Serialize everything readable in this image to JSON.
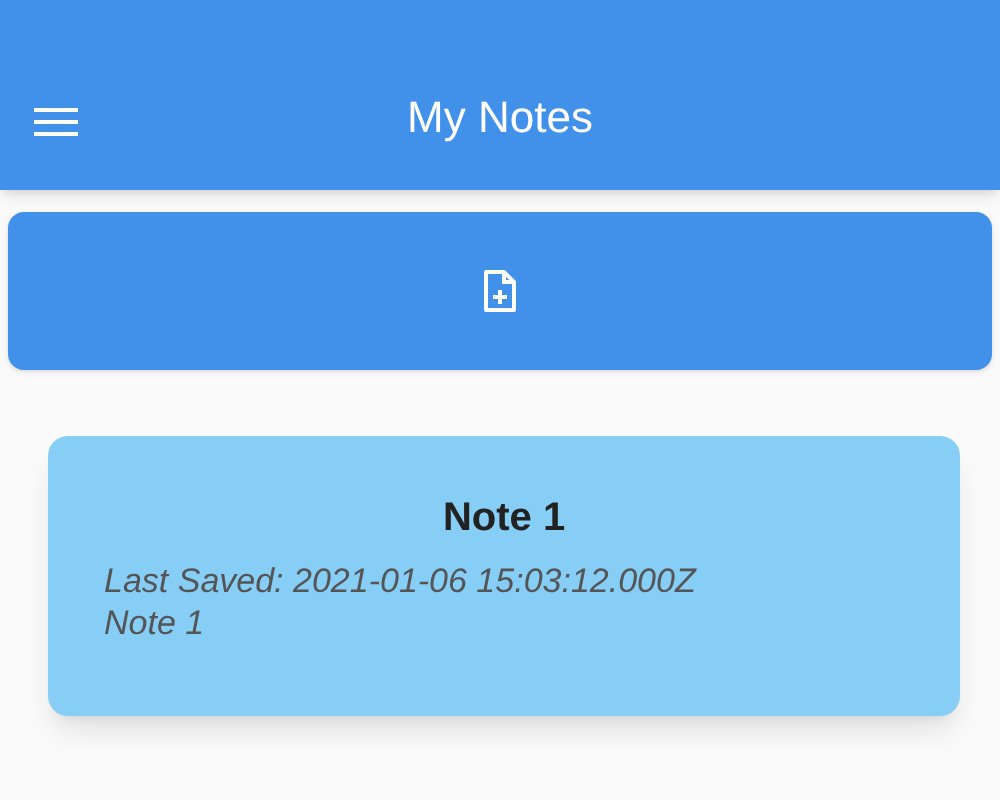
{
  "app_bar": {
    "title": "My Notes"
  },
  "notes": [
    {
      "title": "Note 1",
      "last_saved": "Last Saved: 2021-01-06 15:03:12.000Z",
      "preview": "Note 1"
    }
  ]
}
